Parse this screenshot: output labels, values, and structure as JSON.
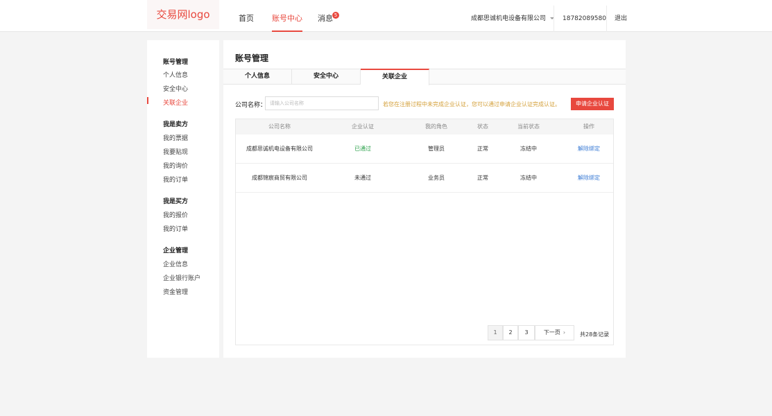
{
  "header": {
    "logo": "交易网logo",
    "nav": [
      {
        "label": "首页"
      },
      {
        "label": "账号中心"
      },
      {
        "label": "消息"
      }
    ],
    "message_badge": "5",
    "company": "成都思诚机电设备有限公司",
    "phone": "18782089580",
    "logout": "退出"
  },
  "sidebar": {
    "sections": [
      {
        "title": "账号管理",
        "items": [
          "个人信息",
          "安全中心",
          "关联企业"
        ]
      },
      {
        "title": "我是卖方",
        "items": [
          "我的票据",
          "我要贴现",
          "我的询价",
          "我的订单"
        ]
      },
      {
        "title": "我是买方",
        "items": [
          "我的报价",
          "我的订单"
        ]
      },
      {
        "title": "企业管理",
        "items": [
          "企业信息",
          "企业银行账户",
          "资金管理"
        ]
      }
    ]
  },
  "main": {
    "title": "账号管理",
    "tabs": [
      "个人信息",
      "安全中心",
      "关联企业"
    ],
    "search_label": "公司名称：",
    "search_placeholder": "请输入公司名称",
    "tip": "若您在注册过程中未完成企业认证，您可以通过申请企业认证完成认证。",
    "apply_button": "申请企业认证",
    "table": {
      "headers": [
        "公司名称",
        "企业认证",
        "我的角色",
        "状态",
        "当前状态",
        "操作"
      ],
      "rows": [
        [
          "成都思诚机电设备有限公司",
          "已通过",
          "管理员",
          "正常",
          "冻结中",
          "解除绑定"
        ],
        [
          "成都锦宸商贸有限公司",
          "未通过",
          "业务员",
          "正常",
          "冻结中",
          "解除绑定"
        ]
      ]
    },
    "pagination": {
      "pages": [
        "1",
        "2",
        "3"
      ],
      "next": "下一页",
      "total": "共28条记录"
    }
  },
  "colors": {
    "accent": "#e8483e",
    "success": "#2aa04a",
    "link": "#3a7bd5",
    "tip": "#d4a03a"
  }
}
